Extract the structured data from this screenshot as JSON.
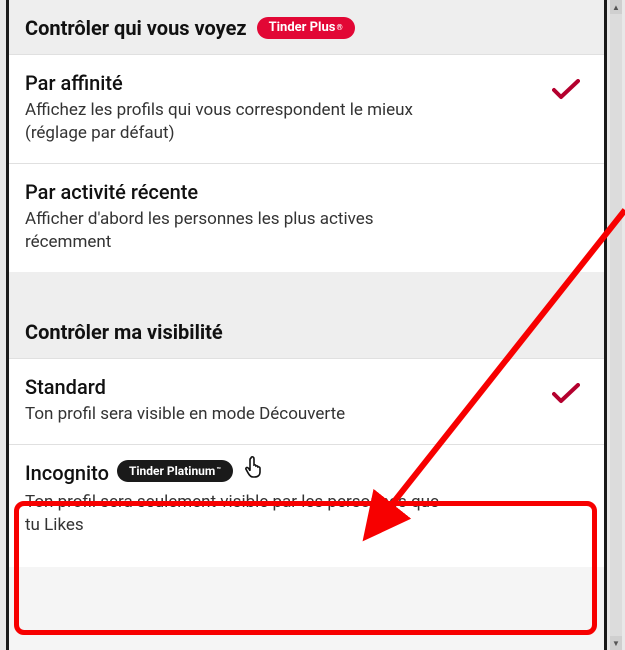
{
  "sections": {
    "who_you_see": {
      "title": "Contrôler qui vous voyez",
      "badge": {
        "label": "Tinder Plus",
        "reg": "®"
      },
      "options": {
        "affinity": {
          "title": "Par affinité",
          "desc": "Affichez les profils qui vous correspondent le mieux (réglage par défaut)",
          "selected": true
        },
        "recent": {
          "title": "Par activité récente",
          "desc": "Afficher d'abord les personnes les plus actives récemment",
          "selected": false
        }
      }
    },
    "visibility": {
      "title": "Contrôler ma visibilité",
      "options": {
        "standard": {
          "title": "Standard",
          "desc": "Ton profil sera visible en mode Découverte",
          "selected": true
        },
        "incognito": {
          "title": "Incognito",
          "badge": {
            "label": "Tinder Platinum",
            "tm": "™"
          },
          "desc": "Ton profil sera seulement visible par les personnes que tu Likes",
          "selected": false
        }
      }
    }
  },
  "colors": {
    "accent": "#e20735",
    "check": "#b4002e",
    "annotation": "#f70000"
  }
}
